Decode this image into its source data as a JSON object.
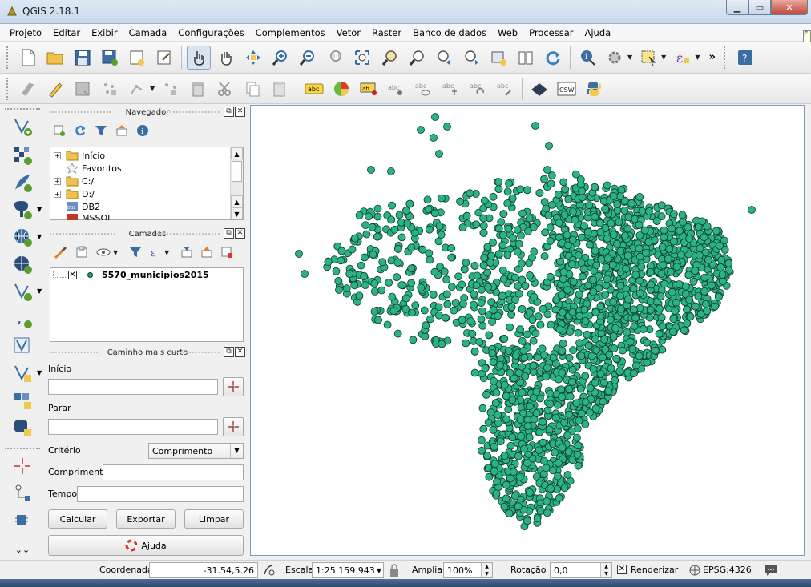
{
  "window": {
    "title": "QGIS 2.18.1",
    "controls": [
      "minimize",
      "maximize",
      "close"
    ]
  },
  "menu": [
    "Projeto",
    "Editar",
    "Exibir",
    "Camada",
    "Configurações",
    "Complementos",
    "Vetor",
    "Raster",
    "Banco de dados",
    "Web",
    "Processar",
    "Ajuda"
  ],
  "tooltip_fragment": "F",
  "toolbar_more": "»",
  "navigator": {
    "title": "Navegador",
    "items": [
      {
        "label": "Início",
        "icon": "folder-icon",
        "expandable": true
      },
      {
        "label": "Favoritos",
        "icon": "star-icon",
        "expandable": false
      },
      {
        "label": "C:/",
        "icon": "folder-icon",
        "expandable": true
      },
      {
        "label": "D:/",
        "icon": "folder-icon",
        "expandable": true
      },
      {
        "label": "DB2",
        "icon": "db2-icon",
        "expandable": false
      },
      {
        "label": "MSSQL",
        "icon": "mssql-icon",
        "expandable": false
      }
    ]
  },
  "layers": {
    "title": "Camadas",
    "items": [
      {
        "label": "5570_municipios2015",
        "checked": true,
        "color": "#1fa37a"
      }
    ]
  },
  "shortest_path": {
    "title": "Caminho mais curto",
    "start_label": "Início",
    "start_value": "",
    "stop_label": "Parar",
    "stop_value": "",
    "criterion_label": "Critério",
    "criterion_value": "Comprimento",
    "length_label": "Comprimento",
    "length_value": "",
    "time_label": "Tempo",
    "time_value": "",
    "calc_button": "Calcular",
    "export_button": "Exportar",
    "clear_button": "Limpar",
    "help_button": "Ajuda"
  },
  "map": {
    "point_fill": "#2cb287",
    "point_stroke": "#0b3b2a",
    "background": "#ffffff"
  },
  "status": {
    "coord_label": "Coordenada",
    "coord_value": "-31.54,5.26",
    "scale_label": "Escala",
    "scale_value": "1:25.159.943",
    "magnify_label": "Ampliar",
    "magnify_value": "100%",
    "rotation_label": "Rotação",
    "rotation_value": "0,0",
    "render_label": "Renderizar",
    "render_checked": true,
    "crs_label": "EPSG:4326"
  }
}
